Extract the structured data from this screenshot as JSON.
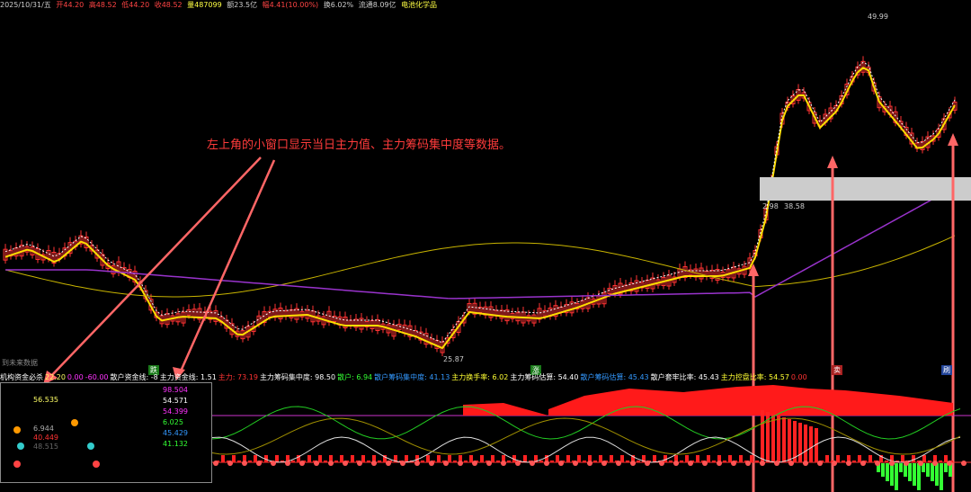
{
  "toolbar": {
    "date": "2025/10/31/五",
    "open": "开44.20",
    "high": "高48.52",
    "low": "低44.20",
    "close": "收48.52",
    "volume": "量487099",
    "amount": "额23.5亿",
    "change": "幅4.41(10.00%)",
    "turnover": "换6.02%",
    "float": "流通8.09亿",
    "sector": "电池化学品"
  },
  "price_labels": {
    "high": "49.99",
    "low": "25.87",
    "box_left": "2.98",
    "box_right": "38.58"
  },
  "annotation": "左上角的小窗口显示当日主力值、主力筹码集中度等数据。",
  "markers": {
    "left_note": "到未来数据",
    "buy1": "跌",
    "buy2": "涨",
    "sell": "卖",
    "right": "刷"
  },
  "indicator_bar": {
    "items": [
      {
        "label": "机构资金必杀",
        "color": "#ffffff"
      },
      {
        "label": "22.20",
        "color": "#ffff66"
      },
      {
        "label": "0.00",
        "color": "#ff33ff"
      },
      {
        "label": "-60.00",
        "color": "#ff33ff"
      },
      {
        "label": "散户资金线: -8",
        "color": "#ffffff"
      },
      {
        "label": "主力资金线: 1.51",
        "color": "#ffffff"
      },
      {
        "label": "主力: 73.19",
        "color": "#ff3333"
      },
      {
        "label": "主力筹码集中度: 98.50",
        "color": "#ffffff"
      },
      {
        "label": "散户: 6.94",
        "color": "#33ff33"
      },
      {
        "label": "散户筹码集中度: 41.13",
        "color": "#3399ff"
      },
      {
        "label": "主力换手率: 6.02",
        "color": "#ffff33"
      },
      {
        "label": "主力筹码估算: 54.40",
        "color": "#ffffff"
      },
      {
        "label": "散户筹码估算: 45.43",
        "color": "#3399ff"
      },
      {
        "label": "散户套牢比率: 45.43",
        "color": "#ffffff"
      },
      {
        "label": "主力控盘比率: 54.57",
        "color": "#ffff33"
      },
      {
        "label": "0.00",
        "color": "#ff3333"
      }
    ]
  },
  "small_window": {
    "left_values": [
      {
        "text": "56.535",
        "color": "#ffff66"
      },
      {
        "text": "6.944",
        "color": "#aaaaaa"
      },
      {
        "text": "40.449",
        "color": "#ff3333"
      },
      {
        "text": "48.515",
        "color": "#666666"
      }
    ],
    "right_values": [
      {
        "text": "98.504",
        "color": "#ff33ff"
      },
      {
        "text": "54.571",
        "color": "#ffffff"
      },
      {
        "text": "54.399",
        "color": "#ff33ff"
      },
      {
        "text": "6.025",
        "color": "#33ff33"
      },
      {
        "text": "45.429",
        "color": "#3399ff"
      },
      {
        "text": "41.132",
        "color": "#33ff33"
      }
    ]
  },
  "colors": {
    "up": "#ff3333",
    "down": "#33ccff",
    "ma5": "#ffffff",
    "ma10": "#ffdd00",
    "ma_long": "#9933cc",
    "arrow": "#ff6666"
  }
}
